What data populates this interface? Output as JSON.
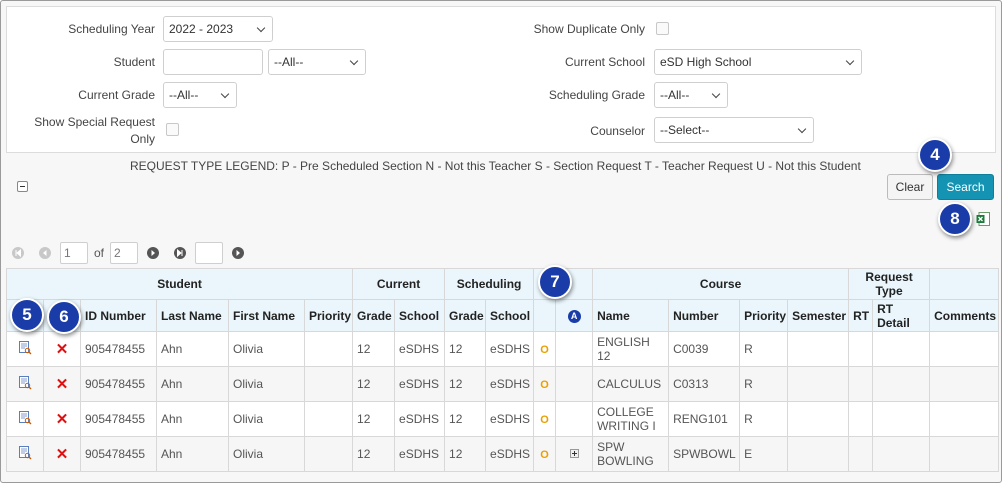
{
  "filters": {
    "scheduling_year_label": "Scheduling Year",
    "scheduling_year_value": "2022 - 2023",
    "student_label": "Student",
    "student_select": "--All--",
    "current_grade_label": "Current Grade",
    "current_grade_value": "--All--",
    "special_request_label_1": "Show Special Request",
    "special_request_label_2": "Only",
    "show_duplicate_label": "Show Duplicate Only",
    "current_school_label": "Current School",
    "current_school_value": "eSD High School",
    "scheduling_grade_label": "Scheduling Grade",
    "scheduling_grade_value": "--All--",
    "counselor_label": "Counselor",
    "counselor_value": "--Select--"
  },
  "legend": "REQUEST TYPE LEGEND: P - Pre Scheduled Section N - Not this Teacher S - Section Request T - Teacher Request U - Not this Student",
  "buttons": {
    "clear": "Clear",
    "search": "Search"
  },
  "callouts": {
    "c4": "4",
    "c5": "5",
    "c6": "6",
    "c7": "7",
    "c8": "8"
  },
  "pager": {
    "page": "1",
    "of": "of",
    "total": "2"
  },
  "table": {
    "groups": {
      "student": "Student",
      "current": "Current",
      "scheduling": "Scheduling",
      "course": "Course",
      "request_type_1": "Request",
      "request_type_2": "Type"
    },
    "columns": {
      "id": "ID Number",
      "last": "Last Name",
      "first": "First Name",
      "priority": "Priority",
      "cur_grade": "Grade",
      "cur_school": "School",
      "sch_grade": "Grade",
      "sch_school": "School",
      "a_icon": "A",
      "name": "Name",
      "number": "Number",
      "c_priority": "Priority",
      "semester": "Semester",
      "rt": "RT",
      "rt_detail": "RT Detail",
      "comments": "Comments"
    },
    "rows": [
      {
        "id": "905478455",
        "last": "Ahn",
        "first": "Olivia",
        "priority": "",
        "cur_grade": "12",
        "cur_school": "eSDHS",
        "sch_grade": "12",
        "sch_school": "eSDHS",
        "o": "O",
        "name_1": "ENGLISH",
        "name_2": "12",
        "number": "C0039",
        "c_priority": "R"
      },
      {
        "id": "905478455",
        "last": "Ahn",
        "first": "Olivia",
        "priority": "",
        "cur_grade": "12",
        "cur_school": "eSDHS",
        "sch_grade": "12",
        "sch_school": "eSDHS",
        "o": "O",
        "name_1": "CALCULUS",
        "name_2": "",
        "number": "C0313",
        "c_priority": "R"
      },
      {
        "id": "905478455",
        "last": "Ahn",
        "first": "Olivia",
        "priority": "",
        "cur_grade": "12",
        "cur_school": "eSDHS",
        "sch_grade": "12",
        "sch_school": "eSDHS",
        "o": "O",
        "name_1": "COLLEGE",
        "name_2": "WRITING I",
        "number": "RENG101",
        "c_priority": "R"
      },
      {
        "id": "905478455",
        "last": "Ahn",
        "first": "Olivia",
        "priority": "",
        "cur_grade": "12",
        "cur_school": "eSDHS",
        "sch_grade": "12",
        "sch_school": "eSDHS",
        "o": "O",
        "name_1": "SPW",
        "name_2": "BOWLING",
        "number": "SPWBOWL",
        "c_priority": "E"
      }
    ]
  },
  "colors": {
    "accent": "#1493b2",
    "callout": "#1a3ca8",
    "header_bg": "#eaf6fb",
    "delete": "#dd1111",
    "o_mark": "#e8a000"
  },
  "icons": {
    "view": "view-detail-icon",
    "delete": "delete-x-icon",
    "excel": "excel-export-icon",
    "expand": "expand-plus-icon"
  }
}
